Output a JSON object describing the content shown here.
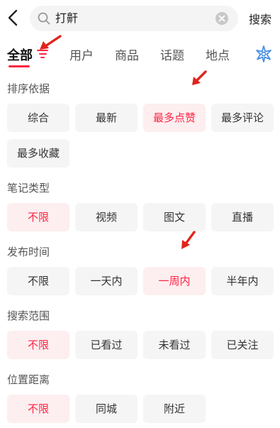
{
  "search": {
    "value": "打鼾",
    "button_label": "搜索"
  },
  "tabs": [
    {
      "label": "全部",
      "active": true
    },
    {
      "label": "用户",
      "active": false
    },
    {
      "label": "商品",
      "active": false
    },
    {
      "label": "话题",
      "active": false
    },
    {
      "label": "地点",
      "active": false
    }
  ],
  "sections": [
    {
      "title": "排序依据",
      "options": [
        "综合",
        "最新",
        "最多点赞",
        "最多评论",
        "最多收藏"
      ],
      "selected": "最多点赞"
    },
    {
      "title": "笔记类型",
      "options": [
        "不限",
        "视频",
        "图文",
        "直播"
      ],
      "selected": "不限"
    },
    {
      "title": "发布时间",
      "options": [
        "不限",
        "一天内",
        "一周内",
        "半年内"
      ],
      "selected": "一周内"
    },
    {
      "title": "搜索范围",
      "options": [
        "不限",
        "已看过",
        "未看过",
        "已关注"
      ],
      "selected": "不限"
    },
    {
      "title": "位置距离",
      "options": [
        "不限",
        "同城",
        "附近"
      ],
      "selected": "不限"
    }
  ],
  "colors": {
    "accent": "#ff2442",
    "chip_bg": "#f5f5f5",
    "chip_selected_bg": "#fdeef0",
    "annotation_arrow": "#e0241c"
  },
  "icons": [
    "back-arrow-icon",
    "search-icon",
    "clear-icon",
    "filter-icon",
    "magic-sparkle-icon",
    "annotation-arrow-icon"
  ]
}
